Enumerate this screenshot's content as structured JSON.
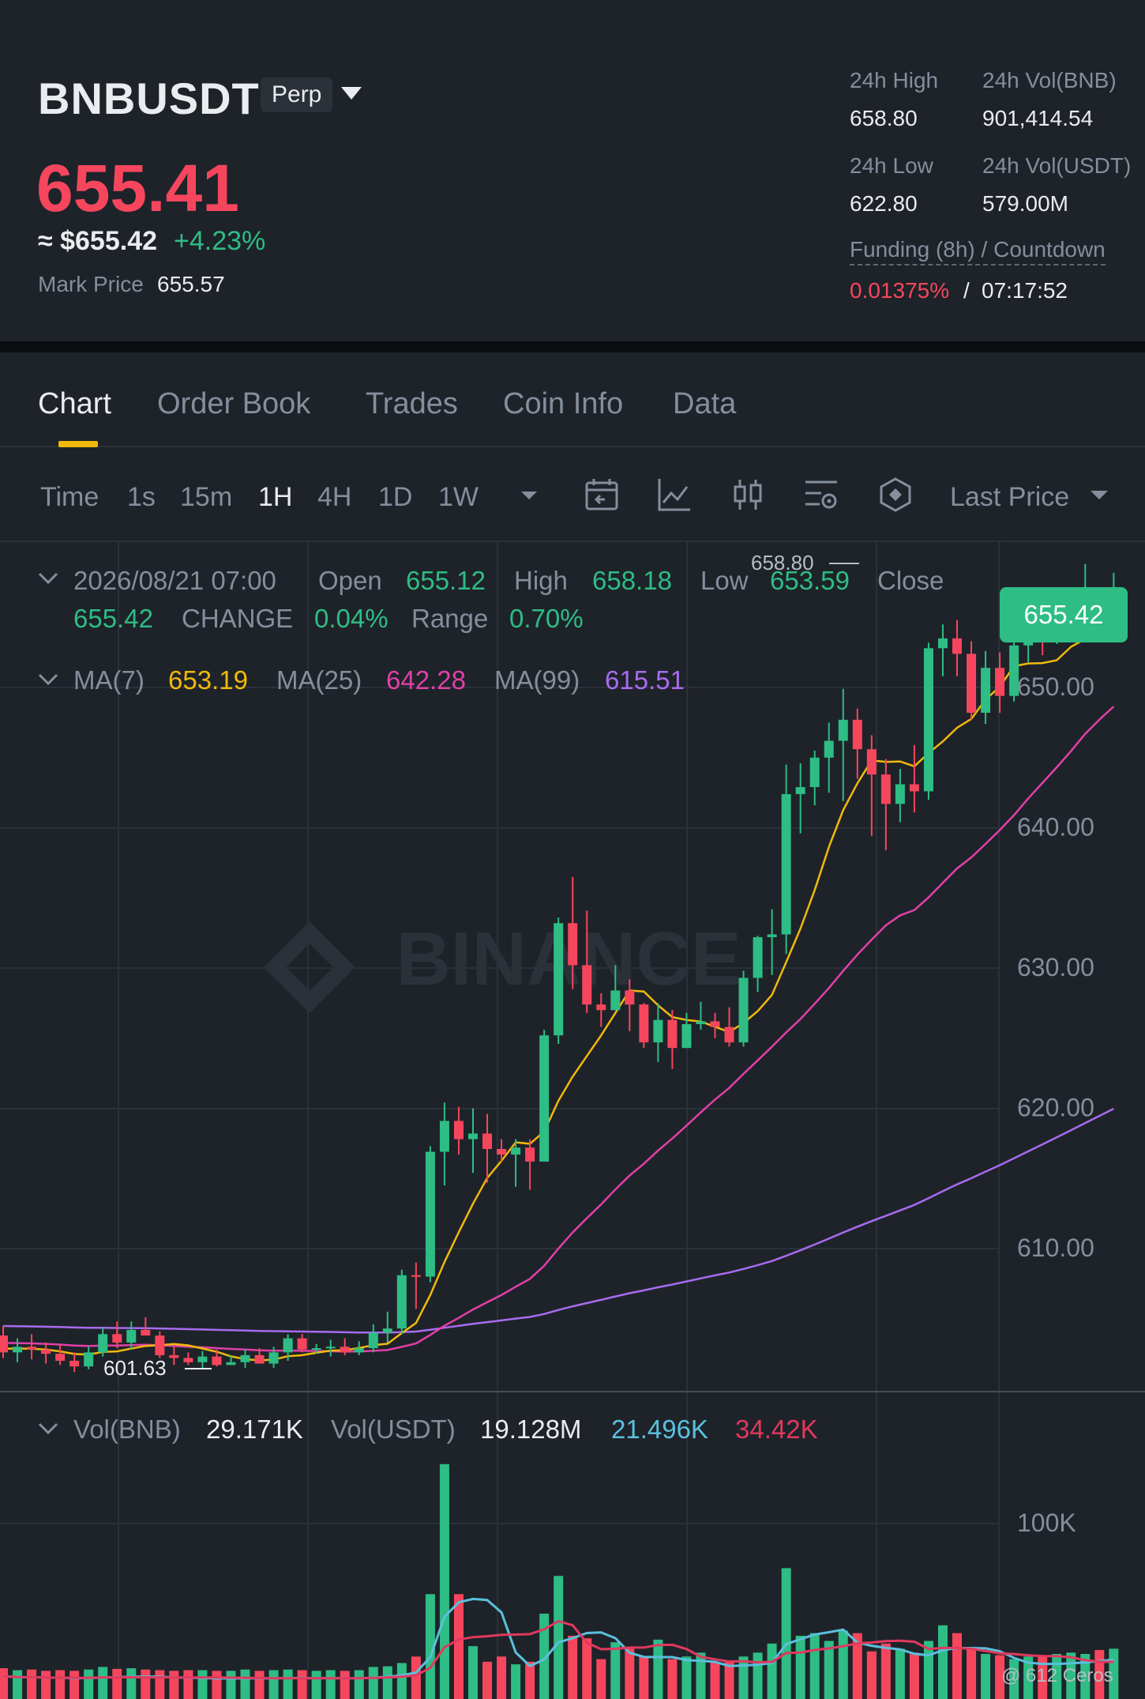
{
  "header": {
    "symbol": "BNBUSDT",
    "contract_badge": "Perp",
    "last_price": "655.41",
    "approx_price": "≈ $655.42",
    "change_pct": "+4.23%",
    "mark_price_label": "Mark Price",
    "mark_price": "655.57",
    "stats": {
      "high_label": "24h High",
      "high": "658.80",
      "vol_bnb_label": "24h Vol(BNB)",
      "vol_bnb": "901,414.54",
      "low_label": "24h Low",
      "low": "622.80",
      "vol_usdt_label": "24h Vol(USDT)",
      "vol_usdt": "579.00M",
      "funding_label": "Funding (8h) / Countdown",
      "funding_rate": "0.01375%",
      "funding_slash": "/",
      "countdown": "07:17:52"
    }
  },
  "tabs": [
    "Chart",
    "Order Book",
    "Trades",
    "Coin Info",
    "Data"
  ],
  "toolbar": {
    "time_label": "Time",
    "intervals": [
      "1s",
      "15m",
      "1H",
      "4H",
      "1D",
      "1W"
    ],
    "price_type": "Last Price",
    "icons": [
      "chevron-down-icon",
      "calendar-icon",
      "indicator-icon",
      "candle-style-icon",
      "settings-icon",
      "depth-icon"
    ]
  },
  "candle_info": {
    "datetime": "2026/08/21 07:00",
    "open_label": "Open",
    "open": "655.12",
    "high_label": "High",
    "high": "658.18",
    "low_label": "Low",
    "low": "653.59",
    "close_label": "Close",
    "close": "655.42",
    "change_label": "CHANGE",
    "change": "0.04%",
    "range_label": "Range",
    "range": "0.70%"
  },
  "ma_info": {
    "ma7_label": "MA(7)",
    "ma7": "653.19",
    "ma25_label": "MA(25)",
    "ma25": "642.28",
    "ma99_label": "MA(99)",
    "ma99": "615.51"
  },
  "vol_info": {
    "vol_bnb_label": "Vol(BNB)",
    "vol_bnb": "29.171K",
    "vol_usdt_label": "Vol(USDT)",
    "vol_usdt": "19.128M",
    "ma5": "21.496K",
    "ma10": "34.42K"
  },
  "watermark": "BINANCE",
  "footer": "@ 612 Ceros",
  "colors": {
    "up": "#2ebd85",
    "down": "#f6465d",
    "ma7": "#f0b90b",
    "ma25": "#e040a8",
    "ma99": "#a86bf0",
    "vol_ma5": "#5bc0de",
    "vol_ma10": "#e0395e",
    "accent": "#f0b90b"
  },
  "chart_data": {
    "type": "candlestick",
    "price_ticks": [
      "650.00",
      "640.00",
      "630.00",
      "620.00",
      "610.00"
    ],
    "volume_ticks": [
      "100K"
    ],
    "ylim": [
      599,
      665
    ],
    "current_price_label": "655.42",
    "max_marker": "658.80",
    "min_marker": "601.63",
    "candles": [
      [
        603.8,
        604.5,
        602.2,
        602.6
      ],
      [
        602.6,
        603.6,
        601.9,
        603.0
      ],
      [
        603.0,
        603.9,
        602.1,
        602.8
      ],
      [
        602.8,
        603.3,
        601.8,
        602.5
      ],
      [
        602.5,
        603.1,
        601.7,
        602.0
      ],
      [
        602.0,
        602.6,
        601.2,
        601.6
      ],
      [
        601.6,
        603.0,
        601.4,
        602.6
      ],
      [
        602.6,
        604.4,
        602.3,
        603.9
      ],
      [
        603.9,
        604.8,
        602.9,
        603.3
      ],
      [
        603.3,
        604.8,
        602.8,
        604.2
      ],
      [
        604.2,
        605.1,
        603.8,
        603.8
      ],
      [
        603.8,
        604.1,
        602.2,
        602.4
      ],
      [
        602.4,
        603.0,
        601.7,
        602.2
      ],
      [
        602.2,
        602.6,
        601.7,
        601.9
      ],
      [
        601.9,
        602.7,
        601.5,
        602.3
      ],
      [
        602.3,
        602.8,
        601.6,
        601.7
      ],
      [
        601.7,
        602.4,
        601.7,
        601.9
      ],
      [
        601.9,
        602.8,
        601.5,
        602.4
      ],
      [
        602.4,
        602.9,
        601.8,
        601.8
      ],
      [
        601.8,
        603.0,
        601.5,
        602.6
      ],
      [
        602.6,
        603.9,
        602.0,
        603.6
      ],
      [
        603.6,
        603.9,
        602.6,
        602.8
      ],
      [
        602.8,
        603.2,
        602.5,
        602.9
      ],
      [
        602.9,
        603.5,
        602.3,
        603.0
      ],
      [
        603.0,
        603.6,
        602.4,
        602.6
      ],
      [
        602.6,
        603.4,
        602.4,
        602.9
      ],
      [
        602.9,
        604.6,
        602.6,
        604.0
      ],
      [
        604.0,
        605.5,
        603.3,
        604.3
      ],
      [
        604.3,
        608.5,
        603.9,
        608.1
      ],
      [
        608.1,
        609.0,
        605.7,
        608.0
      ],
      [
        608.0,
        617.3,
        607.6,
        616.9
      ],
      [
        616.9,
        620.4,
        614.5,
        619.1
      ],
      [
        619.1,
        620.1,
        616.7,
        617.8
      ],
      [
        617.8,
        620.0,
        615.4,
        618.2
      ],
      [
        618.2,
        619.6,
        614.7,
        617.1
      ],
      [
        617.1,
        617.8,
        616.2,
        616.7
      ],
      [
        616.7,
        617.8,
        614.4,
        617.2
      ],
      [
        617.2,
        617.8,
        614.2,
        616.2
      ],
      [
        616.2,
        625.6,
        616.2,
        625.2
      ],
      [
        625.2,
        633.6,
        624.6,
        633.2
      ],
      [
        633.2,
        636.5,
        628.5,
        630.2
      ],
      [
        630.2,
        634.1,
        626.8,
        627.4
      ],
      [
        627.4,
        628.2,
        625.8,
        627.0
      ],
      [
        627.0,
        630.2,
        627.0,
        628.4
      ],
      [
        628.4,
        629.2,
        625.5,
        627.4
      ],
      [
        627.4,
        627.5,
        624.3,
        624.7
      ],
      [
        624.7,
        627.5,
        623.3,
        626.3
      ],
      [
        626.3,
        627.0,
        622.8,
        624.3
      ],
      [
        624.3,
        626.8,
        624.3,
        626.0
      ],
      [
        626.0,
        627.6,
        625.6,
        626.2
      ],
      [
        626.2,
        626.8,
        625.0,
        625.8
      ],
      [
        625.8,
        627.2,
        624.4,
        624.7
      ],
      [
        624.7,
        629.8,
        624.4,
        629.3
      ],
      [
        629.3,
        632.3,
        628.3,
        632.2
      ],
      [
        632.2,
        634.2,
        629.5,
        632.4
      ],
      [
        632.4,
        644.5,
        631.0,
        642.4
      ],
      [
        642.4,
        644.6,
        639.6,
        642.9
      ],
      [
        642.9,
        645.5,
        641.6,
        645.0
      ],
      [
        645.0,
        647.5,
        642.5,
        646.2
      ],
      [
        646.2,
        649.9,
        641.9,
        647.7
      ],
      [
        647.7,
        648.5,
        643.5,
        645.6
      ],
      [
        645.6,
        646.6,
        639.4,
        643.8
      ],
      [
        643.8,
        644.9,
        638.4,
        641.7
      ],
      [
        641.7,
        644.2,
        640.4,
        643.1
      ],
      [
        643.1,
        645.9,
        641.1,
        642.6
      ],
      [
        642.6,
        653.2,
        642.0,
        652.8
      ],
      [
        652.8,
        654.5,
        650.8,
        653.5
      ],
      [
        653.5,
        654.8,
        650.8,
        652.4
      ],
      [
        652.4,
        653.3,
        647.7,
        648.2
      ],
      [
        648.2,
        652.6,
        647.4,
        651.4
      ],
      [
        651.4,
        652.5,
        648.2,
        649.4
      ],
      [
        649.4,
        654.0,
        649.0,
        653.0
      ],
      [
        653.0,
        654.8,
        651.8,
        654.1
      ],
      [
        654.1,
        654.8,
        652.3,
        653.7
      ],
      [
        653.7,
        655.7,
        653.1,
        653.8
      ],
      [
        653.8,
        655.3,
        653.5,
        654.9
      ],
      [
        654.9,
        658.8,
        654.0,
        655.4
      ],
      [
        655.4,
        656.5,
        653.9,
        654.6
      ],
      [
        655.12,
        658.18,
        653.59,
        655.42
      ]
    ],
    "volume": [
      3,
      1.5,
      2,
      1,
      1.5,
      1,
      2,
      4,
      2.5,
      3,
      2,
      1.5,
      1,
      1.5,
      1.5,
      1,
      1,
      2,
      1,
      1.5,
      2,
      1.5,
      1,
      1.5,
      1,
      1.5,
      4,
      4.5,
      7,
      12,
      60,
      160,
      60,
      20,
      8,
      12,
      6,
      8,
      45,
      74,
      28,
      26,
      10,
      23,
      18,
      12,
      25,
      10,
      12,
      15,
      8,
      9,
      12,
      15,
      22,
      80,
      28,
      30,
      24,
      32,
      30,
      16,
      22,
      18,
      15,
      24,
      36,
      30,
      18,
      14,
      13,
      10,
      12,
      13,
      14,
      15,
      14,
      17,
      18
    ],
    "series": [
      {
        "name": "MA(7)",
        "value": "653.19"
      },
      {
        "name": "MA(25)",
        "value": "642.28"
      },
      {
        "name": "MA(99)",
        "value": "615.51"
      }
    ]
  }
}
